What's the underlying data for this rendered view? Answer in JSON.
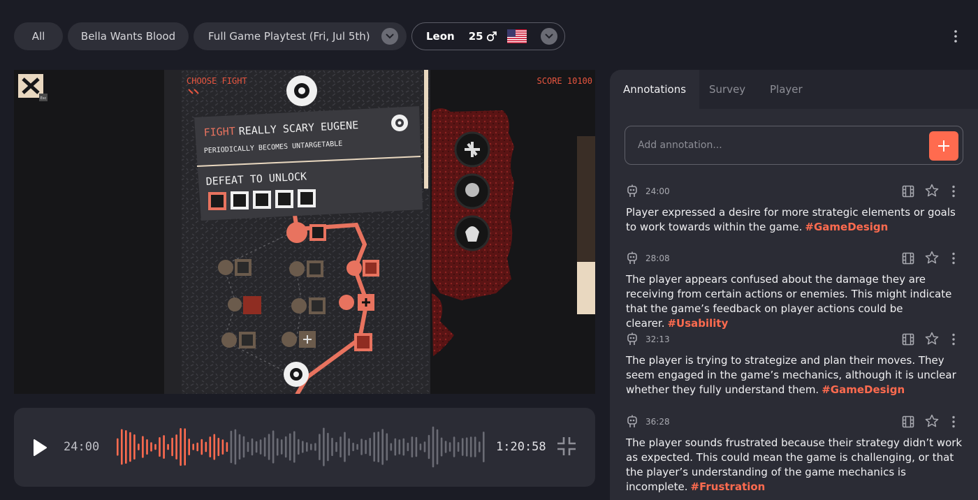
{
  "filters": {
    "all_label": "All",
    "game_label": "Bella Wants Blood",
    "session_label": "Full Game Playtest (Fri, Jul 5th)",
    "player": {
      "name": "Leon",
      "age": "25",
      "gender_icon": "male-icon",
      "flag_icon": "us-flag-icon"
    }
  },
  "video": {
    "hud_choose": "CHOOSE FIGHT",
    "hud_score": "SCORE 10100",
    "close_icon": "close-icon",
    "esc_label": "Esc",
    "card_fight": "FIGHT",
    "card_enemy": "REALLY SCARY EUGENE",
    "card_sub": "PERIODICALLY BECOMES UNTARGETABLE",
    "card_unlock": "DEFEAT TO UNLOCK"
  },
  "playbar": {
    "current_time": "24:00",
    "total_time": "1:20:58",
    "progress": 0.3
  },
  "panel": {
    "tabs": [
      "Annotations",
      "Survey",
      "Player"
    ],
    "active_tab": "Annotations",
    "input_placeholder": "Add annotation...",
    "accent": "#ff6b4f",
    "annotations": [
      {
        "time": "24:00",
        "text": "Player expressed a desire for more strategic elements or goals to work towards within the game.",
        "tag": "#GameDesign"
      },
      {
        "time": "28:08",
        "text": "The player appears confused about the damage they are receiving from certain actions or enemies. This might indicate that the game’s feedback on player actions could be clearer.",
        "tag": "#Usability"
      },
      {
        "time": "32:13",
        "text": "The player is trying to strategize and plan their moves. They seem engaged in the game’s mechanics, although it is unclear whether they fully understand them.",
        "tag": "#GameDesign"
      },
      {
        "time": "36:28",
        "text": "The player sounds frustrated because their strategy didn’t work as expected. This could mean the game is challenging, or that the player’s understanding of the game mechanics is incomplete.",
        "tag": "#Frustration"
      }
    ]
  }
}
